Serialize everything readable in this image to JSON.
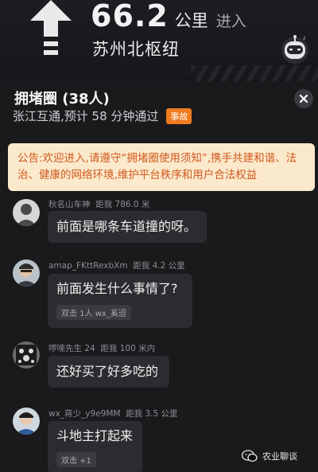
{
  "navigation": {
    "distance_value": "66.2",
    "distance_unit": "公里",
    "action": "进入",
    "road_name": "苏州北枢纽"
  },
  "room": {
    "title": "拥堵圈 (38人)",
    "subtitle": "张江互通,预计 58 分钟通过",
    "badge": "事故"
  },
  "notice": {
    "text": "公告:欢迎进入,请遵守“拥堵圈使用须知”,携手共建和谐、法治、健康的网络环境,维护平台秩序和用户合法权益"
  },
  "messages": [
    {
      "user": "秋名山车神",
      "distance": "距我 786.0 米",
      "text": "前面是哪条车道撞的呀。",
      "reaction": ""
    },
    {
      "user": "amap_FKttRexbXm",
      "distance": "距我 4.2 公里",
      "text": "前面发生什么事情了?",
      "reaction": "双击 1人 wx_奚迢"
    },
    {
      "user": "啰嗦先生 24",
      "distance": "距我 100 米内",
      "text": "还好买了好多吃的",
      "reaction": ""
    },
    {
      "user": "wx_蒋少_y9e9MM",
      "distance": "距我 3.5 公里",
      "text": "斗地主打起来",
      "reaction": "双击 +1"
    }
  ],
  "watermark": {
    "text": "农业聊谈"
  },
  "colors": {
    "accent_orange": "#f07b1e",
    "notice_bg": "#fbe9cc",
    "notice_text": "#d15a1f"
  }
}
